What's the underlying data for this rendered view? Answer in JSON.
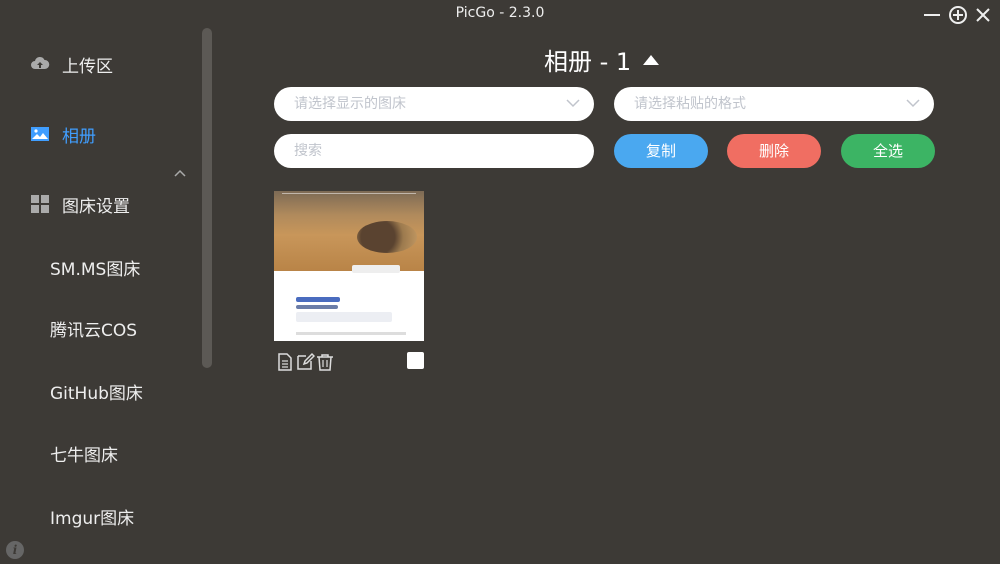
{
  "window": {
    "title": "PicGo - 2.3.0"
  },
  "sidebar": {
    "items": [
      {
        "label": "上传区",
        "icon": "cloud-upload-icon"
      },
      {
        "label": "相册",
        "icon": "image-icon",
        "active": true
      },
      {
        "label": "图床设置",
        "icon": "grid-icon"
      }
    ],
    "sub_items": [
      {
        "label": "SM.MS图床"
      },
      {
        "label": "腾讯云COS"
      },
      {
        "label": "GitHub图床"
      },
      {
        "label": "七牛图床"
      },
      {
        "label": "Imgur图床"
      }
    ]
  },
  "main": {
    "title": "相册 - 1",
    "filters": {
      "bed_select_placeholder": "请选择显示的图床",
      "paste_format_placeholder": "请选择粘贴的格式",
      "search_placeholder": "搜索"
    },
    "buttons": {
      "copy": "复制",
      "delete": "删除",
      "select_all": "全选"
    }
  },
  "colors": {
    "background": "#3d3a36",
    "accent": "#409eff",
    "copy": "#4aa8f0",
    "delete": "#f06e62",
    "select_all": "#3cb464"
  }
}
